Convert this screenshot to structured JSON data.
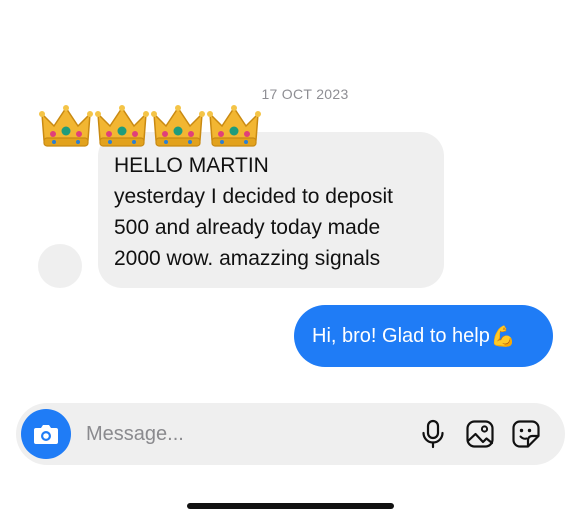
{
  "conversation": {
    "date": "17 OCT 2023",
    "incoming": {
      "crowns": [
        "👑",
        "👑",
        "👑",
        "👑"
      ],
      "lines": [
        "HELLO MARTIN",
        "yesterday I decided to deposit",
        "500 and already today made",
        "2000 wow. amazzing signals"
      ]
    },
    "outgoing": {
      "text": "Hi, bro! Glad to help",
      "emoji": "💪"
    }
  },
  "composer": {
    "placeholder": "Message...",
    "icons": [
      "camera-icon",
      "microphone-icon",
      "gallery-icon",
      "sticker-icon"
    ]
  },
  "colors": {
    "accent": "#1f7cf6",
    "bubble_incoming": "#efefef",
    "muted_text": "#8e8e93"
  }
}
